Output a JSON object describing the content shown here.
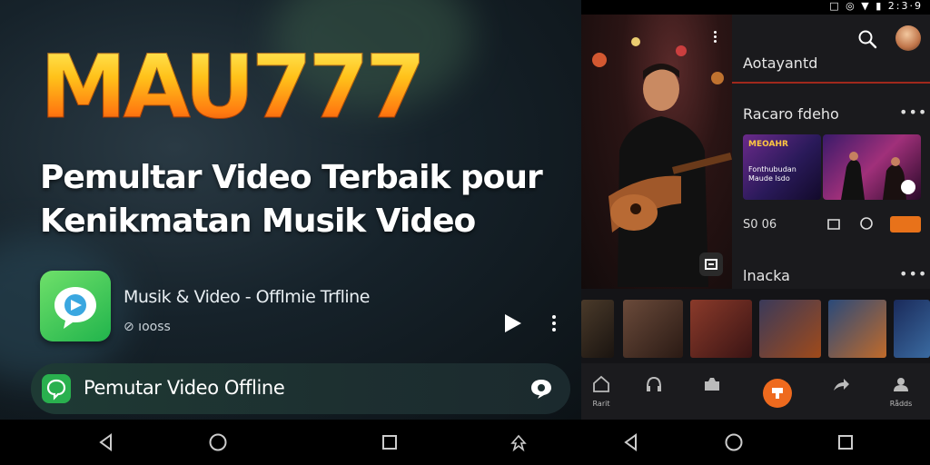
{
  "promo": {
    "brand": "MAU777",
    "headline_line1": "Pemultar Video Terbaik pour",
    "headline_line2": "Kenikmatan Musik Video",
    "app": {
      "title": "Musik & Video - Offlmie Trfline",
      "subtitle": "⊘ ıooss"
    },
    "search_bar_label": "Pemutar Video Offline",
    "colors": {
      "brand_top": "#fff36a",
      "brand_bottom": "#d23a08",
      "app_icon": "#29b04e"
    }
  },
  "phone": {
    "status_text": "□ ◎ ▼ ▮ 2:3·9",
    "menu_title": "Aotayantd",
    "section1": {
      "title": "Racaro fdeho",
      "more": "•••"
    },
    "thumb1": {
      "title": "MEOAHR",
      "subtitle": "Fonthubudan Maude lsdo"
    },
    "stats": "S0   06",
    "section2": {
      "title": "lnacka",
      "more": "•••"
    },
    "bottom_nav": [
      {
        "icon": "home-icon",
        "label": "Rarit"
      },
      {
        "icon": "headphones-icon",
        "label": ""
      },
      {
        "icon": "library-icon",
        "label": ""
      },
      {
        "icon": "music-center-icon",
        "label": ""
      },
      {
        "icon": "share-icon",
        "label": ""
      },
      {
        "icon": "profile-icon",
        "label": "Rådds"
      }
    ],
    "accent_color": "#ee6a1e"
  }
}
